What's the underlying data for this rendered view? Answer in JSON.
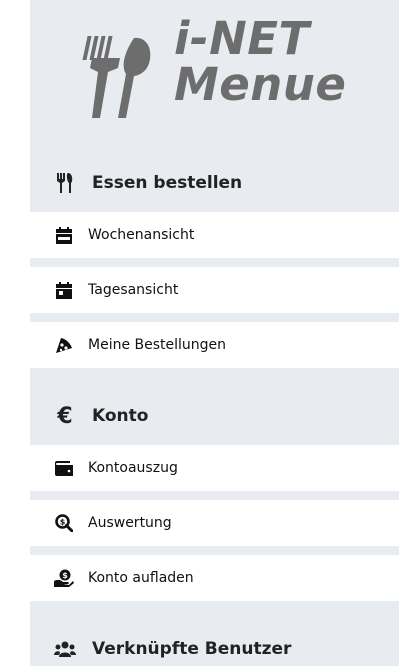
{
  "logo": {
    "line1": "i-NET",
    "line2": "Menue"
  },
  "sections": [
    {
      "label": "Essen bestellen",
      "icon": "utensils-icon",
      "items": [
        {
          "label": "Wochenansicht",
          "icon": "calendar-week-icon"
        },
        {
          "label": "Tagesansicht",
          "icon": "calendar-day-icon"
        },
        {
          "label": "Meine Bestellungen",
          "icon": "pizza-slice-icon"
        }
      ]
    },
    {
      "label": "Konto",
      "icon": "euro-icon",
      "items": [
        {
          "label": "Kontoauszug",
          "icon": "wallet-icon"
        },
        {
          "label": "Auswertung",
          "icon": "search-dollar-icon"
        },
        {
          "label": "Konto aufladen",
          "icon": "hand-holding-dollar-icon"
        }
      ]
    },
    {
      "label": "Verknüpfte Benutzer",
      "icon": "users-icon",
      "items": []
    }
  ],
  "colors": {
    "sidebar_bg": "#e8ebf0",
    "item_bg": "#ffffff",
    "logo_text": "#6d6d6d",
    "text": "#111111"
  }
}
